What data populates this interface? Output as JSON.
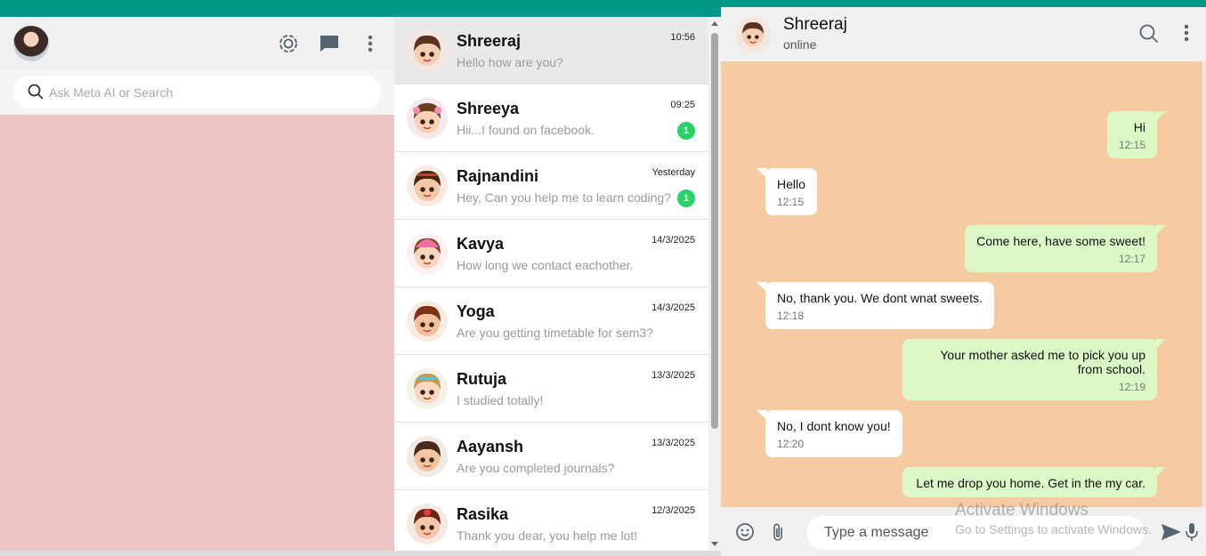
{
  "left_panel": {
    "icons": [
      "status-icon",
      "new-chat-icon",
      "menu-icon"
    ],
    "search_placeholder": "Ask Meta AI or Search",
    "background": "#edc4c4"
  },
  "chats": [
    {
      "name": "Shreeraj",
      "time": "10:56",
      "message": "Hello how are you?",
      "unread": "",
      "active": true
    },
    {
      "name": "Shreeya",
      "time": "09:25",
      "message": "Hii...I found on facebook.",
      "unread": "1"
    },
    {
      "name": "Rajnandini",
      "time": "Yesterday",
      "message": "Hey, Can you help me to learn coding?",
      "unread": "1"
    },
    {
      "name": "Kavya",
      "time": "14/3/2025",
      "message": "How long we contact eachother.",
      "unread": ""
    },
    {
      "name": "Yoga",
      "time": "14/3/2025",
      "message": "Are you getting timetable for sem3?",
      "unread": ""
    },
    {
      "name": "Rutuja",
      "time": "13/3/2025",
      "message": "I studied totally!",
      "unread": ""
    },
    {
      "name": "Aayansh",
      "time": "13/3/2025",
      "message": "Are you completed journals?",
      "unread": ""
    },
    {
      "name": "Rasika",
      "time": "12/3/2025",
      "message": "Thank you dear, you help me lot!",
      "unread": ""
    }
  ],
  "conversation": {
    "name": "Shreeraj",
    "status": "online",
    "messages": [
      {
        "dir": "out",
        "text": "Hi",
        "time": "12:15"
      },
      {
        "dir": "in",
        "text": "Hello",
        "time": "12:15"
      },
      {
        "dir": "out",
        "text": "Come here, have some sweet!",
        "time": "12:17"
      },
      {
        "dir": "in",
        "text": "No, thank you. We dont wnat sweets.",
        "time": "12:18"
      },
      {
        "dir": "out",
        "text": "Your mother asked me to pick you up from school.",
        "time": "12:19"
      },
      {
        "dir": "in",
        "text": "No, I dont know you!",
        "time": "12:20"
      },
      {
        "dir": "out",
        "text": "Let me drop you home. Get in the my car.",
        "time": ""
      }
    ],
    "input_placeholder": "Type a message",
    "background": "#f7cba2",
    "out_bubble_color": "#dcf8c6"
  },
  "watermark": {
    "line1": "Activate Windows",
    "line2": "Go to Settings to activate Windows."
  }
}
